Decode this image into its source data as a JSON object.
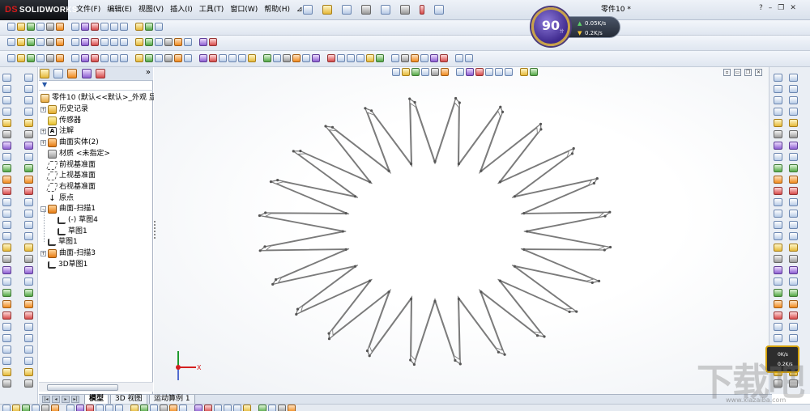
{
  "app": {
    "logo_mark": "DS",
    "logo_text": "SOLIDWORKS",
    "document_title": "零件10 *"
  },
  "menu": {
    "items": [
      "文件(F)",
      "编辑(E)",
      "视图(V)",
      "插入(I)",
      "工具(T)",
      "窗口(W)",
      "帮助(H)"
    ],
    "overflow": "⊿"
  },
  "window_controls": {
    "help": "?",
    "minimize": "–",
    "restore": "❐",
    "close": "✕"
  },
  "perf_badge": {
    "value": "90",
    "unit": "分",
    "up_speed": "0.05K/s",
    "down_speed": "0.2K/s"
  },
  "feature_manager": {
    "expand_label": "»",
    "filter_icon": "filter-icon",
    "root": "零件10 (默认<<默认>_外观 显",
    "nodes": [
      {
        "label": "历史记录",
        "icon": "history-folder-icon",
        "expander": "+",
        "indent": 0
      },
      {
        "label": "传感器",
        "icon": "sensor-icon",
        "expander": "",
        "indent": 0
      },
      {
        "label": "注解",
        "icon": "annotation-icon",
        "expander": "+",
        "indent": 0
      },
      {
        "label": "曲面实体(2)",
        "icon": "surface-body-icon",
        "expander": "+",
        "indent": 0
      },
      {
        "label": "材质 <未指定>",
        "icon": "material-icon",
        "expander": "",
        "indent": 0
      },
      {
        "label": "前视基准面",
        "icon": "plane-icon",
        "expander": "",
        "indent": 0
      },
      {
        "label": "上视基准面",
        "icon": "plane-icon",
        "expander": "",
        "indent": 0
      },
      {
        "label": "右视基准面",
        "icon": "plane-icon",
        "expander": "",
        "indent": 0
      },
      {
        "label": "原点",
        "icon": "origin-icon",
        "expander": "",
        "indent": 0
      },
      {
        "label": "曲面-扫描1",
        "icon": "sweep-surface-icon",
        "expander": "–",
        "indent": 0
      },
      {
        "label": "(-) 草图4",
        "icon": "sketch-icon",
        "expander": "",
        "indent": 1
      },
      {
        "label": "草图1",
        "icon": "sketch-icon",
        "expander": "",
        "indent": 1
      },
      {
        "label": "草图1",
        "icon": "sketch-icon",
        "expander": "",
        "indent": 0
      },
      {
        "label": "曲面-扫描3",
        "icon": "sweep-surface-icon",
        "expander": "+",
        "indent": 0
      },
      {
        "label": "3D草图1",
        "icon": "3d-sketch-icon",
        "expander": "",
        "indent": 0
      }
    ]
  },
  "bottom_tabs": [
    "模型",
    "3D 视图",
    "运动算例 1"
  ],
  "active_tab": "模型",
  "nav_buttons": [
    "|◂",
    "◂",
    "▸",
    "▸|"
  ],
  "triad_axis": {
    "x": "X"
  },
  "net_speed_box": {
    "up": "0K/s",
    "down": "0.2K/s"
  },
  "watermark": {
    "main": "下载吧",
    "url": "www.xiazaiba.com"
  },
  "colors": {
    "accent": "#d51a1a",
    "sketch_line": "#7a7a7a",
    "triad_x": "#d42020",
    "triad_y": "#1f9a2e",
    "triad_z": "#1f3fc2"
  },
  "model": {
    "teeth_count": 24,
    "outer_ratio": 1.38,
    "inner_ratio": 1.0
  }
}
